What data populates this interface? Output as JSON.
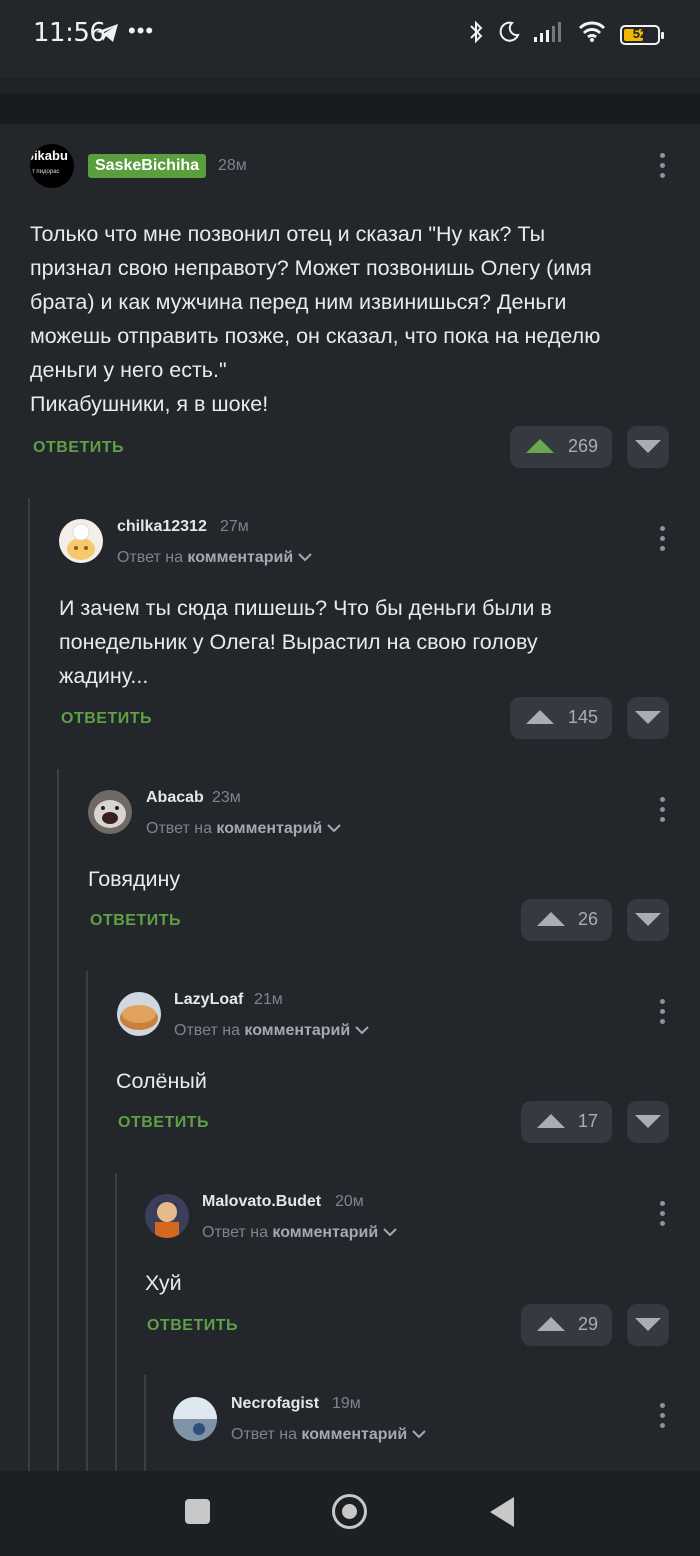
{
  "status": {
    "time": "11:56",
    "dots": "•••",
    "battery": "52"
  },
  "comments": [
    {
      "author": "SaskeBichiha",
      "time": "28м",
      "avatar_text": "pikabu",
      "avatar_sub": "т пидорас",
      "text_lines": [
        "Только что мне позвонил отец и сказал \"Ну как? Ты",
        "признал свою неправоту? Может позвонишь Олегу (имя",
        "брата) и как мужчина перед ним извинишься? Деньги",
        "можешь отправить позже, он сказал, что пока на неделю",
        "деньги у него есть.\"",
        "Пикабушники, я в шоке!"
      ],
      "reply_label": "ОТВЕТИТЬ",
      "votes": "269"
    },
    {
      "author": "chilka12312",
      "time": "27м",
      "reply_prefix": "Ответ на",
      "reply_target": "комментарий",
      "text_lines": [
        "И зачем ты сюда пишешь? Что бы деньги были в",
        "понедельник у Олега! Вырастил на свою голову",
        "жадину..."
      ],
      "reply_label": "ОТВЕТИТЬ",
      "votes": "145"
    },
    {
      "author": "Abacab",
      "time": "23м",
      "reply_prefix": "Ответ на",
      "reply_target": "комментарий",
      "text_lines": [
        "Говядину"
      ],
      "reply_label": "ОТВЕТИТЬ",
      "votes": "26"
    },
    {
      "author": "LazyLoaf",
      "time": "21м",
      "reply_prefix": "Ответ на",
      "reply_target": "комментарий",
      "text_lines": [
        "Солёный"
      ],
      "reply_label": "ОТВЕТИТЬ",
      "votes": "17"
    },
    {
      "author": "Malovato.Budet",
      "time": "20м",
      "reply_prefix": "Ответ на",
      "reply_target": "комментарий",
      "text_lines": [
        "Хуй"
      ],
      "reply_label": "ОТВЕТИТЬ",
      "votes": "29"
    },
    {
      "author": "Necrofagist",
      "time": "19м",
      "reply_prefix": "Ответ на",
      "reply_target": "комментарий"
    }
  ]
}
